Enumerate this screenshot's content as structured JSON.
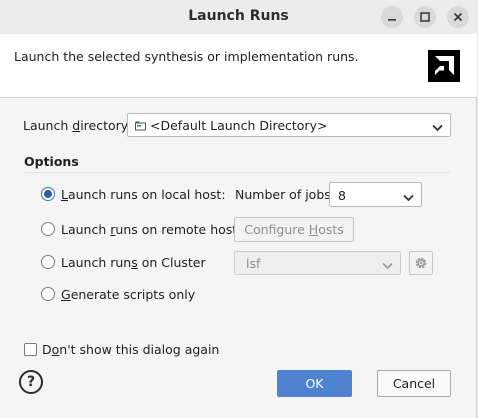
{
  "window": {
    "title": "Launch Runs"
  },
  "banner": {
    "description": "Launch the selected synthesis or implementation runs."
  },
  "launch_directory": {
    "label_pre": "Launch ",
    "label_mnemonic": "d",
    "label_post": "irectory:",
    "value": "<Default Launch Directory>"
  },
  "options": {
    "heading": "Options",
    "local_host": {
      "pre": "",
      "mn": "L",
      "post": "aunch runs on local host:",
      "checked": true
    },
    "jobs": {
      "label": "Number of jobs:",
      "value": "8"
    },
    "remote_hosts": {
      "pre": "Launch ",
      "mn": "r",
      "post": "uns on remote hosts",
      "checked": false
    },
    "configure_hosts": {
      "pre": "Configure ",
      "mn": "H",
      "post": "osts"
    },
    "cluster": {
      "pre": "Launch run",
      "mn": "s",
      "post": " on Cluster",
      "checked": false,
      "value": "lsf"
    },
    "scripts_only": {
      "pre": "",
      "mn": "G",
      "post": "enerate scripts only",
      "checked": false
    }
  },
  "dont_show": {
    "pre": "D",
    "mn": "o",
    "post": "n't show this dialog again",
    "checked": false
  },
  "buttons": {
    "ok": "OK",
    "cancel": "Cancel"
  },
  "icons": {
    "help": "question-icon",
    "settings": "gear-icon",
    "logo": "amd-logo"
  }
}
